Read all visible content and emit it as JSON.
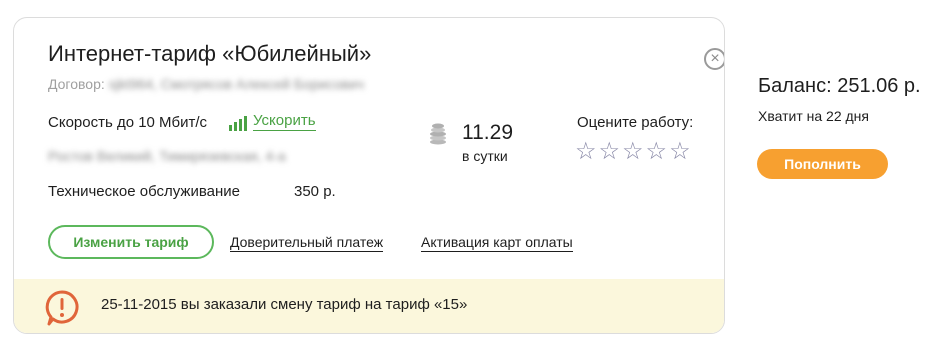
{
  "card": {
    "close_label": "×",
    "title": "Интернет-тариф «Юбилейный»",
    "contract_label": "Договор:",
    "contract_value": "sjkt964, Смотрясов Алексей Борисович",
    "speed": "Скорость до 10 Мбит/с",
    "boost_label": "Ускорить",
    "address": "Ростов Великий, Тимирязевская, 4-а",
    "service_label": "Техническое обслуживание",
    "service_price": "350 р.",
    "cost_value": "11.29",
    "cost_unit": "в сутки",
    "rate_label": "Оцените работу:",
    "stars": [
      "☆",
      "☆",
      "☆",
      "☆",
      "☆"
    ],
    "change_tariff": "Изменить тариф",
    "trust_payment": "Доверительный платеж",
    "activate_cards": "Активация карт оплаты",
    "notice": "25-11-2015 вы заказали смену тариф на тариф «15»"
  },
  "side": {
    "balance": "Баланс: 251.06 р.",
    "enough": "Хватит на 22 дня",
    "topup": "Пополнить"
  },
  "colors": {
    "green": "#4aa244",
    "orange": "#f7a030",
    "notice_bg": "#fbf7dc",
    "notice_icon": "#e0653a"
  }
}
